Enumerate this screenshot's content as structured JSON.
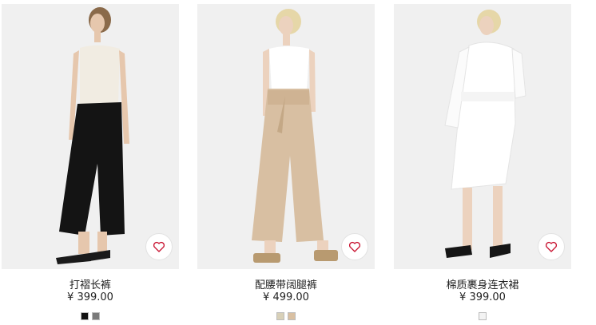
{
  "accent": "#c8102e",
  "products": [
    {
      "name": "打褶长裤",
      "price": "¥ 399.00",
      "favorite_icon": "heart-icon",
      "swatches": [
        {
          "color": "#111111"
        },
        {
          "color": "#7a7a7a"
        }
      ]
    },
    {
      "name": "配腰带阔腿裤",
      "price": "¥ 499.00",
      "favorite_icon": "heart-icon",
      "swatches": [
        {
          "color": "#d8d0b8"
        },
        {
          "color": "#d9c0a2"
        }
      ]
    },
    {
      "name": "棉质裹身连衣裙",
      "price": "¥ 399.00",
      "favorite_icon": "heart-icon",
      "swatches": [
        {
          "color": "#f3f3f3"
        }
      ]
    }
  ]
}
